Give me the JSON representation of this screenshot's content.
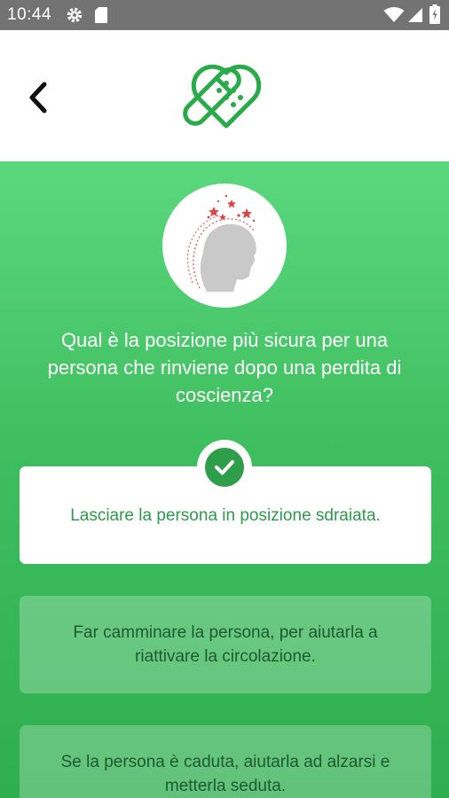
{
  "status_bar": {
    "time": "10:44"
  },
  "quiz": {
    "question": "Qual è la posizione più sicura per una persona che rinviene dopo una  perdita di coscienza?",
    "answers": [
      {
        "label": "Lasciare la persona  in posizione sdraiata.",
        "state": "correct"
      },
      {
        "label": "Far camminare la persona, per aiutarla a riattivare la circolazione.",
        "state": "unselected"
      },
      {
        "label": "Se la persona è caduta, aiutarla ad alzarsi e metterla seduta.",
        "state": "unselected"
      }
    ]
  },
  "colors": {
    "accent": "#2e9e4a",
    "background_top": "#5bd87e",
    "background_bottom": "#2eae4e",
    "status_bar": "#737373"
  },
  "icons": [
    "settings-icon",
    "sd-card-icon",
    "wifi-icon",
    "signal-icon",
    "battery-icon",
    "back-arrow-icon",
    "bandage-heart-logo",
    "check-icon"
  ]
}
